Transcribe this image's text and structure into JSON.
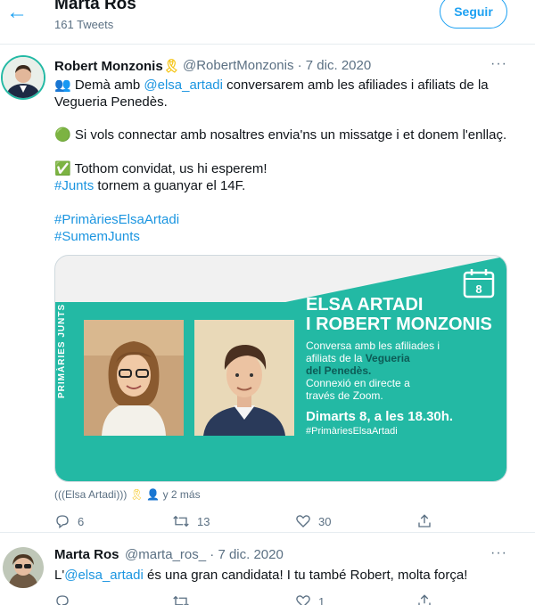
{
  "header": {
    "back_icon": "arrow-left-icon",
    "title": "Marta Ros",
    "tweet_count": "161 Tweets",
    "follow_label": "Seguir"
  },
  "tweet1": {
    "author_name": "Robert Monzonis",
    "ribbon_emoji": "🎗",
    "handle": "@RobertMonzonis",
    "separator": "·",
    "date": "7 dic. 2020",
    "more": "···",
    "line1_pre": "👥 Demà amb ",
    "line1_link": "@elsa_artadi",
    "line1_post": " conversarem amb les afiliades i afiliats de la",
    "line2": "Vegueria Penedès.",
    "line3": "🟢 Si vols connectar amb nosaltres  envia'ns un missatge i et donem l'enllaç.",
    "line4": "✅ Tothom convidat, us hi esperem!",
    "line5_link": "#Junts",
    "line5_post": " tornem a guanyar el 14F.",
    "hashtag1": "#PrimàriesElsaArtadi",
    "hashtag2": "#SumemJunts",
    "card": {
      "vertical": "PRIMÀRIES JUNTS",
      "calendar_day": "8",
      "title1": "ELSA ARTADI",
      "title2": "I ROBERT MONZONIS",
      "body1": "Conversa amb les afiliades i",
      "body2_pre": "afiliats de la ",
      "body2_bold": "Vegueria",
      "body3_bold": "del Penedès.",
      "body4": "Connexió en directe a",
      "body5": "través de Zoom.",
      "date": "Dimarts 8, a les 18.30h.",
      "hashtag": "#PrimàriesElsaArtadi"
    },
    "tagged_text": "(((Elsa Artadi)))",
    "tagged_more": "y 2 más",
    "reply_count": "6",
    "retweet_count": "13",
    "like_count": "30"
  },
  "tweet2": {
    "author_name": "Marta Ros",
    "handle": "@marta_ros_",
    "separator": "·",
    "date": "7 dic. 2020",
    "more": "···",
    "text_pre": "L'",
    "text_link": "@elsa_artadi",
    "text_post": " és una gran candidata! I tu també Robert, molta força!",
    "like_count": "1"
  },
  "colors": {
    "accent": "#1da1f2",
    "card_teal": "#23b9a4",
    "muted": "#5b7083"
  }
}
